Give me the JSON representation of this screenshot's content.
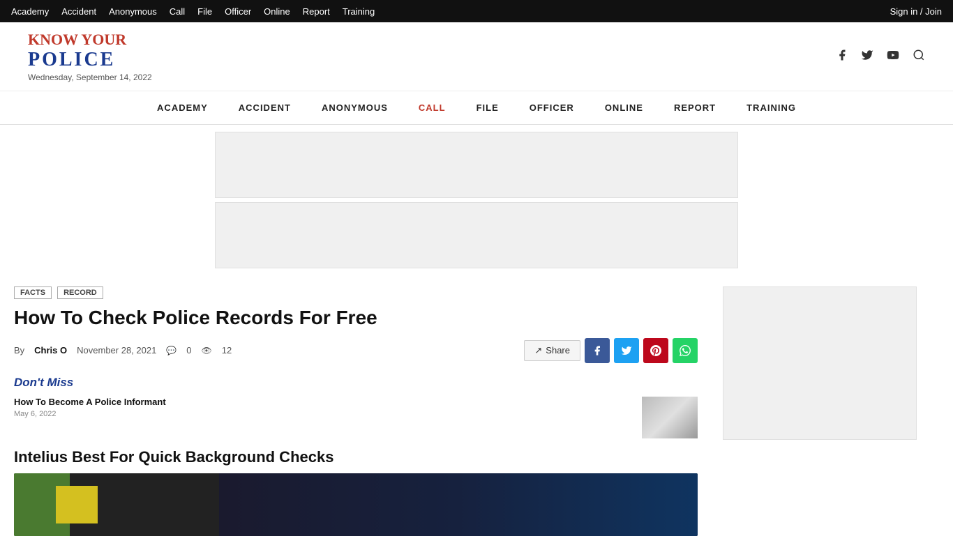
{
  "topbar": {
    "links": [
      "Academy",
      "Accident",
      "Anonymous",
      "Call",
      "File",
      "Officer",
      "Online",
      "Report",
      "Training"
    ],
    "signin": "Sign in / Join"
  },
  "header": {
    "logo_know": "KNOW YOUR",
    "logo_police": "POLICE",
    "date": "Wednesday, September 14, 2022"
  },
  "mainnav": {
    "items": [
      "ACADEMY",
      "ACCIDENT",
      "ANONYMOUS",
      "CALL",
      "FILE",
      "OFFICER",
      "ONLINE",
      "REPORT",
      "TRAINING"
    ]
  },
  "article": {
    "tags": [
      "FACTS",
      "RECORD"
    ],
    "title": "How To Check Police Records For Free",
    "by": "By",
    "author": "Chris O",
    "date": "November 28, 2021",
    "comments": "0",
    "views": "12",
    "share_label": "Share",
    "body_heading": "Intelius Best For Quick Background Checks"
  },
  "dont_miss": {
    "title": "Don't Miss",
    "items": [
      {
        "title": "How To Become A Police Informant",
        "date": "May 6, 2022"
      }
    ]
  },
  "icons": {
    "facebook": "f",
    "twitter": "t",
    "youtube": "▶",
    "search": "🔍",
    "share_arrow": "↗"
  }
}
